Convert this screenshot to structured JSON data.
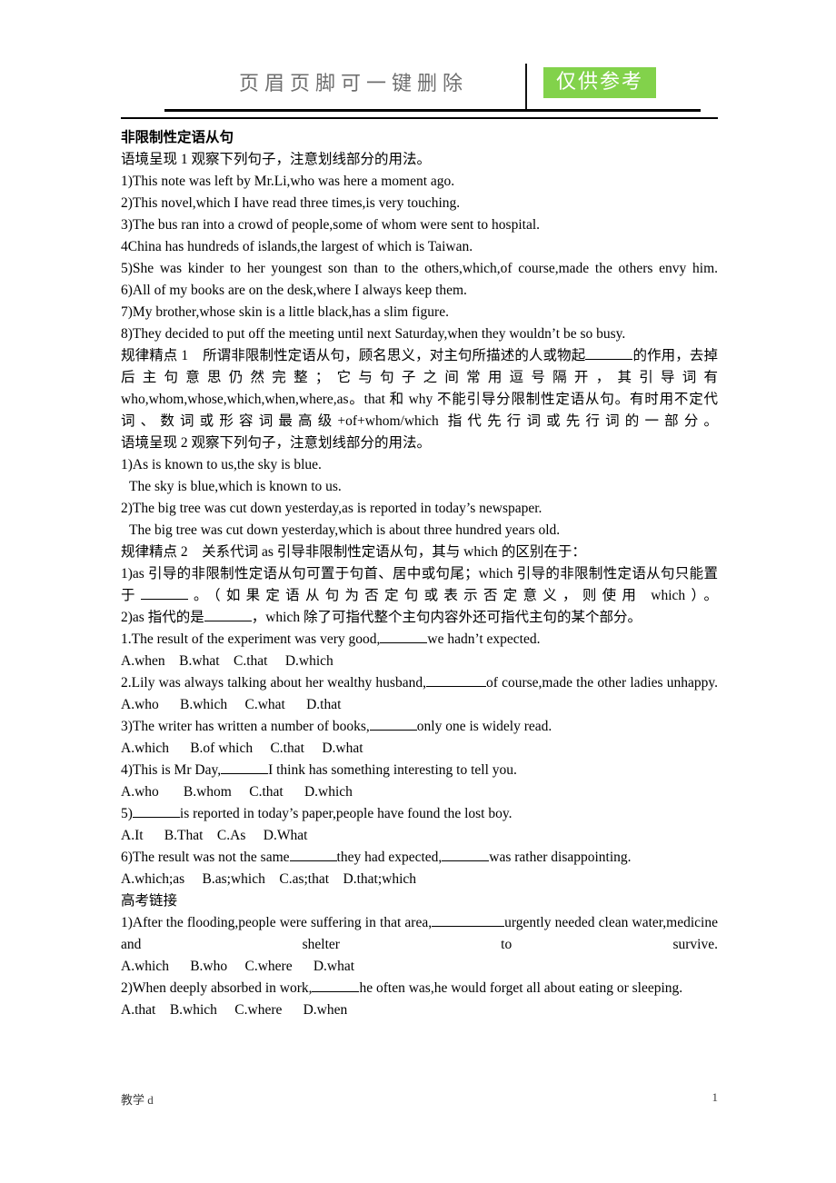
{
  "header": {
    "watermark_text": "页眉页脚可一键删除",
    "badge_text": "仅供参考",
    "badge_color": "#82d24b"
  },
  "document": {
    "title": "非限制性定语从句",
    "section1": {
      "prompt": "语境呈现 1 观察下列句子，注意划线部分的用法。",
      "examples": [
        "1)This note was left by Mr.Li,who was here a moment ago.",
        "2)This novel,which I have read three times,is very touching.",
        "3)The bus ran into a crowd of people,some of whom were sent to hospital.",
        "4China has hundreds of islands,the largest of which is Taiwan.",
        "5)She was kinder to her youngest son than to the others,which,of course,made the others envy him.",
        "6)All of my books are on the desk,where I always keep them.",
        "7)My brother,whose skin is a little black,has a slim figure.",
        "8)They decided to put off the meeting until next Saturday,when they wouldn’t be so busy."
      ]
    },
    "rule1": {
      "label": "规律精点 1",
      "text_before_blank": "所谓非限制性定语从句，顾名思义，对主句所描述的人或物起",
      "text_after_blank": "的作用，去掉后主句意思仍然完整；它与句子之间常用逗号隔开，其引导词有 who,whom,whose,which,when,where,as。that 和 why 不能引导分限制性定语从句。有时用不定代词、数词或形容词最高级+of+whom/which 指代先行词或先行词的一部分。"
    },
    "section2": {
      "prompt": "语境呈现 2 观察下列句子，注意划线部分的用法。",
      "pairs": [
        {
          "main": "1)As is known to us,the sky is blue.",
          "alt": "The sky is blue,which is known to us."
        },
        {
          "main": "2)The big tree was cut down yesterday,as is reported in today’s newspaper.",
          "alt": "The big tree was cut down yesterday,which is about three hundred years old."
        }
      ]
    },
    "rule2": {
      "label": "规律精点 2",
      "intro": "关系代词 as 引导非限制性定语从句，其与 which 的区别在于：",
      "point1_before": "1)as 引导的非限制性定语从句可置于句首、居中或句尾；which 引导的非限制性定语从句只能置于",
      "point1_after": "。（如果定语从句为否定句或表示否定意义，则使用 which）。",
      "point2_before": "2)as 指代的是",
      "point2_after": "，which 除了可指代整个主句内容外还可指代主句的某个部分。"
    },
    "exercises": [
      {
        "stem_before": "1.The result of the experiment was very good,",
        "stem_after": "we hadn’t expected.",
        "options": [
          "A.when",
          "B.what",
          "C.that",
          "D.which"
        ]
      },
      {
        "stem_before": "2.Lily was always talking about her wealthy husband,",
        "stem_after": "of course,made the other ladies unhappy.",
        "options": [
          "A.who",
          "B.which",
          "C.what",
          "D.that"
        ]
      },
      {
        "stem_before": "3)The writer has written a number of books,",
        "stem_after": "only one is widely read.",
        "options": [
          "A.which",
          "B.of which",
          "C.that",
          "D.what"
        ]
      },
      {
        "stem_before": "4)This is Mr Day,",
        "stem_after": "I think has something interesting to tell you.",
        "options": [
          "A.who",
          "B.whom",
          "C.that",
          "D.which"
        ]
      },
      {
        "stem_before": "5)",
        "stem_after": "is reported in today’s paper,people have found the lost boy.",
        "options": [
          "A.It",
          "B.That",
          "C.As",
          "D.What"
        ]
      },
      {
        "stem_before": "6)The result was not the same",
        "stem_mid": "they had expected,",
        "stem_after": "was rather disappointing.",
        "options": [
          "A.which;as",
          "B.as;which",
          "C.as;that",
          "D.that;which"
        ]
      }
    ],
    "gaokao": {
      "heading": "高考链接",
      "items": [
        {
          "stem_before": "1)After the flooding,people were suffering in that area,",
          "stem_after": "urgently needed clean water,medicine and shelter to survive.",
          "options": [
            "A.which",
            "B.who",
            "C.where",
            "D.what"
          ]
        },
        {
          "stem_before": "2)When deeply absorbed in work,",
          "stem_after": "he often was,he would forget all about eating or sleeping.",
          "options": [
            "A.that",
            "B.which",
            "C.where",
            "D.when"
          ]
        }
      ]
    }
  },
  "footer": {
    "left_text": "教学 d",
    "page_number": "1"
  }
}
